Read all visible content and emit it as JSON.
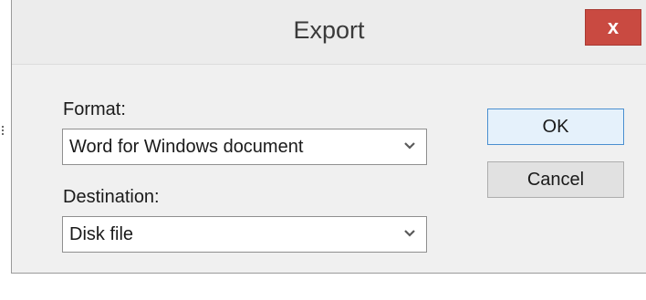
{
  "window": {
    "title": "Export",
    "close_glyph": "x"
  },
  "form": {
    "format_label": "Format:",
    "format_value": "Word for Windows document",
    "destination_label": "Destination:",
    "destination_value": "Disk file"
  },
  "buttons": {
    "ok_label": "OK",
    "cancel_label": "Cancel"
  },
  "colors": {
    "close_button": "#c94a41",
    "default_button_border": "#4a8fd0",
    "dialog_background": "#f0f0f0"
  },
  "icons": {
    "close": "close-icon",
    "dropdown": "chevron-down-icon"
  }
}
